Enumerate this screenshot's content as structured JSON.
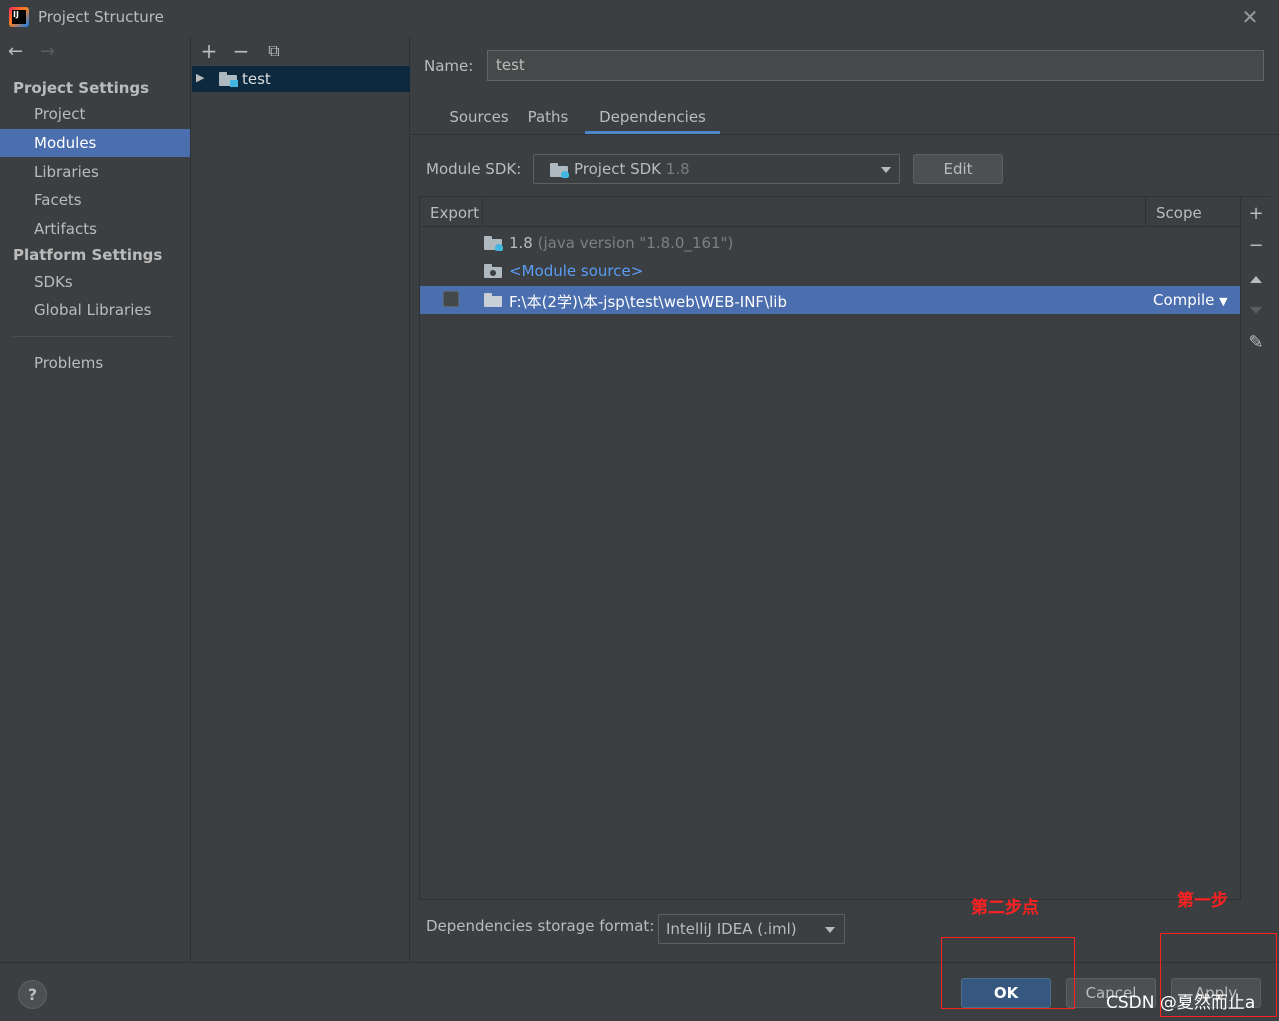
{
  "window": {
    "title": "Project Structure",
    "close_glyph": "✕",
    "app_icon_label": "IJ"
  },
  "nav": {
    "back_glyph": "←",
    "forward_glyph": "→",
    "project_settings_header": "Project Settings",
    "project_settings_items": [
      "Project",
      "Modules",
      "Libraries",
      "Facets",
      "Artifacts"
    ],
    "platform_settings_header": "Platform Settings",
    "platform_settings_items": [
      "SDKs",
      "Global Libraries"
    ],
    "problems": "Problems",
    "selected": "Modules"
  },
  "modules": {
    "toolbar": {
      "add": "+",
      "remove": "−",
      "copy": "⧉"
    },
    "items": [
      {
        "label": "test",
        "expand_glyph": "▶"
      }
    ]
  },
  "main": {
    "name_label": "Name:",
    "name_value": "test",
    "tabs": [
      "Sources",
      "Paths",
      "Dependencies"
    ],
    "active_tab": "Dependencies",
    "module_sdk_label": "Module SDK:",
    "module_sdk_value": "Project SDK",
    "module_sdk_version": "1.8",
    "edit_button": "Edit",
    "table": {
      "col_export": "Export",
      "col_scope": "Scope",
      "rows": [
        {
          "name": "1.8",
          "detail": "(java version \"1.8.0_161\")",
          "icon": "jdk-folder-icon"
        },
        {
          "name": "<Module source>",
          "icon": "module-source-folder-icon"
        },
        {
          "name": "F:\\本(2学)\\本-jsp\\test\\web\\WEB-INF\\lib",
          "scope": "Compile",
          "scope_arrow": "▼",
          "icon": "folder-icon",
          "selected": true
        }
      ]
    },
    "side_tools": {
      "add": "+",
      "remove": "−",
      "edit": "✎"
    },
    "storage_label": "Dependencies storage format:",
    "storage_value": "IntelliJ IDEA (.iml)"
  },
  "footer": {
    "help": "?",
    "ok": "OK",
    "cancel": "Cancel",
    "apply": "Apply"
  },
  "annotations": {
    "step_two": "第二步点",
    "step_one": "第一步",
    "color": "#ff2020"
  },
  "watermark": "CSDN @夏然而止a",
  "colors": {
    "background": "#3c3f41",
    "selection": "#4b6eaf",
    "tree_selection": "#0d293e",
    "link": "#589df6",
    "ok_button": "#365880",
    "tab_underline": "#4a88c7"
  }
}
